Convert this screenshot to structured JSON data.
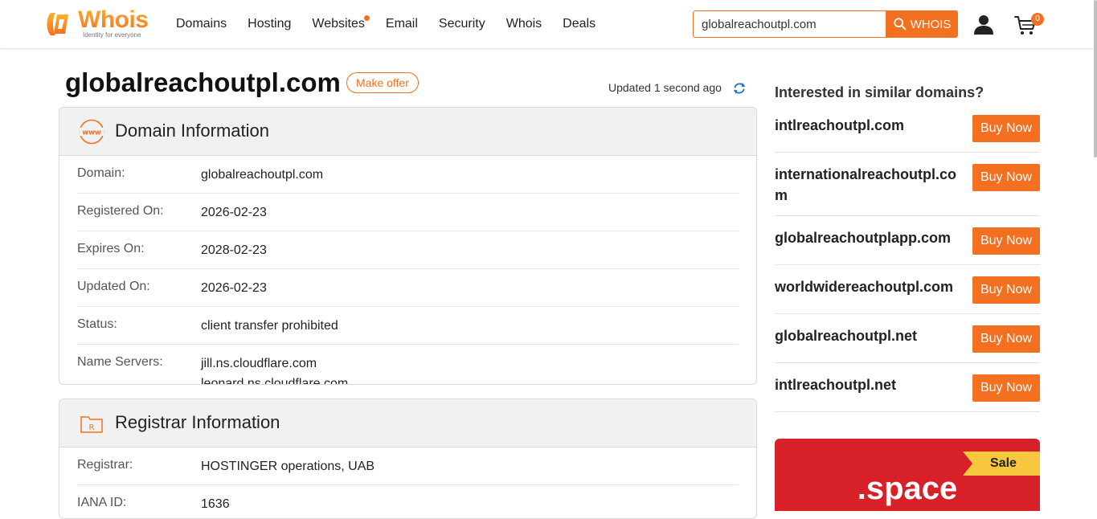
{
  "brand": {
    "name": "Whois",
    "tagline": "Identity for everyone",
    "accent": "#f37021"
  },
  "nav": [
    {
      "label": "Domains"
    },
    {
      "label": "Hosting"
    },
    {
      "label": "Websites",
      "dot": true
    },
    {
      "label": "Email"
    },
    {
      "label": "Security"
    },
    {
      "label": "Whois"
    },
    {
      "label": "Deals"
    }
  ],
  "search": {
    "value": "globalreachoutpl.com",
    "button": "WHOIS"
  },
  "cart": {
    "count": "0"
  },
  "domain": {
    "name": "globalreachoutpl.com",
    "make_offer": "Make offer",
    "updated": "Updated 1 second ago"
  },
  "domain_info": {
    "title": "Domain Information",
    "rows": [
      {
        "label": "Domain:",
        "values": [
          "globalreachoutpl.com"
        ]
      },
      {
        "label": "Registered On:",
        "values": [
          "2026-02-23"
        ]
      },
      {
        "label": "Expires On:",
        "values": [
          "2028-02-23"
        ]
      },
      {
        "label": "Updated On:",
        "values": [
          "2026-02-23"
        ]
      },
      {
        "label": "Status:",
        "values": [
          "client transfer prohibited"
        ]
      },
      {
        "label": "Name Servers:",
        "values": [
          "jill.ns.cloudflare.com",
          "leonard.ns.cloudflare.com"
        ]
      }
    ]
  },
  "registrar_info": {
    "title": "Registrar Information",
    "rows": [
      {
        "label": "Registrar:",
        "values": [
          "HOSTINGER operations, UAB"
        ]
      },
      {
        "label": "IANA ID:",
        "values": [
          "1636"
        ]
      }
    ]
  },
  "sidebar": {
    "title": "Interested in similar domains?",
    "buy_label": "Buy Now",
    "suggestions": [
      "intlreachoutpl.com",
      "internationalreachoutpl.com",
      "globalreachoutplapp.com",
      "worldwidereachoutpl.com",
      "globalreachoutpl.net",
      "intlreachoutpl.net"
    ]
  },
  "promo": {
    "badge": "Sale",
    "text": ".space"
  }
}
